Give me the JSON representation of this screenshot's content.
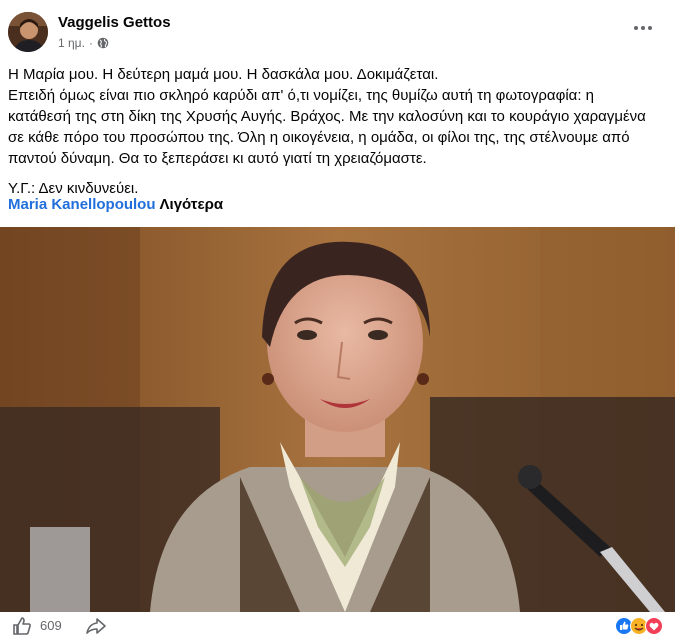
{
  "author": {
    "name": "Vaggelis Gettos",
    "time": "1 ημ.",
    "separator": "·",
    "visibility_icon": "globe-icon"
  },
  "menu": {
    "icon": "more-options-icon"
  },
  "post": {
    "paragraph1": "Η Μαρία μου. Η δεύτερη μαμά μου. Η δασκάλα μου. Δοκιμάζεται.",
    "paragraph2": "Επειδή όμως είναι πιο σκληρό καρύδι απ' ό,τι νομίζει, της θυμίζω αυτή τη φωτογραφία: η κατάθεσή της στη δίκη της Χρυσής Αυγής. Βράχος. Με την καλοσύνη και το κουράγιο χαραγμένα σε κάθε πόρο του προσώπου της. Όλη η οικογένεια, η ομάδα, οι φίλοι της, της στέλνουμε από παντού δύναμη. Θα το ξεπεράσει κι αυτό γιατί τη χρειαζόμαστε.",
    "paragraph3": "Υ.Γ.: Δεν κινδυνεύει.",
    "tagged": "Maria Kanellopoulou",
    "see_more": "Λιγότερα"
  },
  "photo": {
    "subject": "portrait-photo"
  },
  "footer": {
    "like_icon": "thumbs-up-icon",
    "like_count": "609",
    "share_icon": "share-icon",
    "reactions_icon": "reactions-icon"
  },
  "colors": {
    "link": "#216fdb",
    "secondary": "#65676b",
    "like_blue": "#1877f2",
    "love_red": "#f33e58"
  }
}
